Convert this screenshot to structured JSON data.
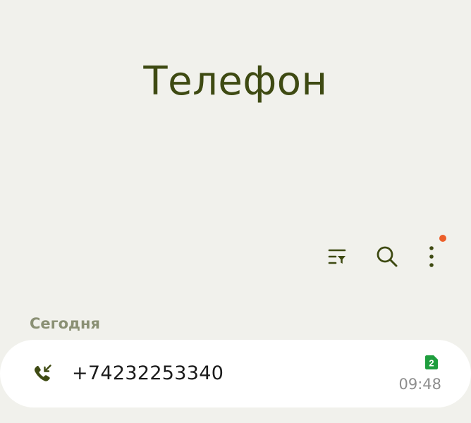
{
  "header": {
    "title": "Телефон"
  },
  "toolbar": {
    "filter_icon": "filter-list-icon",
    "search_icon": "search-icon",
    "more_icon": "more-vertical-icon",
    "notification_dot_color": "#ec5f2a"
  },
  "call_log": {
    "section_label": "Сегодня",
    "items": [
      {
        "number": "+74232253340",
        "time": "09:48",
        "call_type_icon": "incoming-call-icon",
        "sim": "2",
        "sim_color": "#1f9e3e"
      }
    ]
  },
  "colors": {
    "accent": "#3e4a12",
    "background": "#f1f1ec",
    "card": "#ffffff"
  }
}
